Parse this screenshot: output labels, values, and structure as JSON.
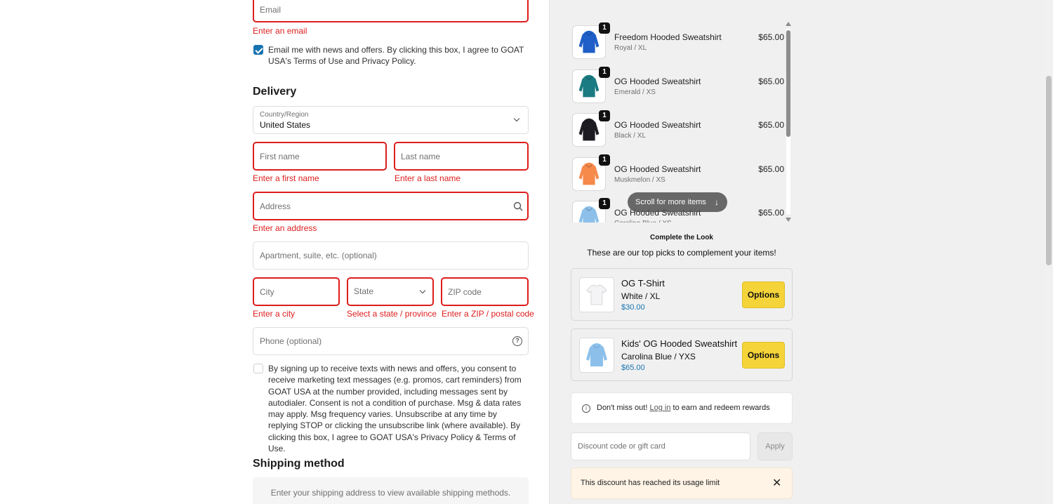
{
  "contact": {
    "email_placeholder": "Email",
    "email_error": "Enter an email",
    "newsletter_text": "Email me with news and offers. By clicking this box, I agree to GOAT USA's Terms of Use and Privacy Policy."
  },
  "delivery": {
    "heading": "Delivery",
    "country_label": "Country/Region",
    "country_value": "United States",
    "first_name_placeholder": "First name",
    "first_name_error": "Enter a first name",
    "last_name_placeholder": "Last name",
    "last_name_error": "Enter a last name",
    "address_placeholder": "Address",
    "address_error": "Enter an address",
    "apartment_placeholder": "Apartment, suite, etc. (optional)",
    "city_placeholder": "City",
    "city_error": "Enter a city",
    "state_placeholder": "State",
    "state_error": "Select a state / province",
    "zip_placeholder": "ZIP code",
    "zip_error": "Enter a ZIP / postal code",
    "phone_placeholder": "Phone (optional)",
    "sms_text": "By signing up to receive texts with news and offers, you consent to receive marketing text messages (e.g. promos, cart reminders) from GOAT USA at the number provided, including messages sent by autodialer. Consent is not a condition of purchase. Msg & data rates may apply. Msg frequency varies. Unsubscribe at any time by replying STOP or clicking the unsubscribe link (where available). By clicking this box, I agree to GOAT USA's Privacy Policy & Terms of Use."
  },
  "shipping": {
    "heading": "Shipping method",
    "placeholder": "Enter your shipping address to view available shipping methods."
  },
  "cart": {
    "items": [
      {
        "name": "Freedom Hooded Sweatshirt",
        "variant": "Royal / XL",
        "price": "$65.00",
        "qty": "1",
        "color": "#1f5fc7"
      },
      {
        "name": "OG Hooded Sweatshirt",
        "variant": "Emerald / XS",
        "price": "$65.00",
        "qty": "1",
        "color": "#1b7b82"
      },
      {
        "name": "OG Hooded Sweatshirt",
        "variant": "Black / XL",
        "price": "$65.00",
        "qty": "1",
        "color": "#1c1c22"
      },
      {
        "name": "OG Hooded Sweatshirt",
        "variant": "Muskmelon / XS",
        "price": "$65.00",
        "qty": "1",
        "color": "#f58a4b"
      },
      {
        "name": "OG Hooded Sweatshirt",
        "variant": "Carolina Blue / XS",
        "price": "$65.00",
        "qty": "1",
        "color": "#8cc0ea"
      }
    ],
    "scroll_hint": "Scroll for more items"
  },
  "complete_look": {
    "title": "Complete the Look",
    "subtitle": "These are our top picks to complement your items!",
    "products": [
      {
        "name": "OG T-Shirt",
        "variant": "White / XL",
        "price": "$30.00",
        "button": "Options",
        "color": "#f4f4f6"
      },
      {
        "name": "Kids' OG Hooded Sweatshirt",
        "variant": "Carolina Blue / YXS",
        "price": "$65.00",
        "button": "Options",
        "color": "#8cc0ea"
      }
    ]
  },
  "rewards": {
    "prefix": "Don't miss out! ",
    "link": "Log in",
    "suffix": " to earn and redeem rewards"
  },
  "discount": {
    "placeholder": "Discount code or gift card",
    "apply_label": "Apply",
    "notice": "This discount has reached its usage limit"
  },
  "colors": {
    "error": "#dd1d1d",
    "accent": "#1773b0",
    "options_button": "#f5d43a"
  }
}
